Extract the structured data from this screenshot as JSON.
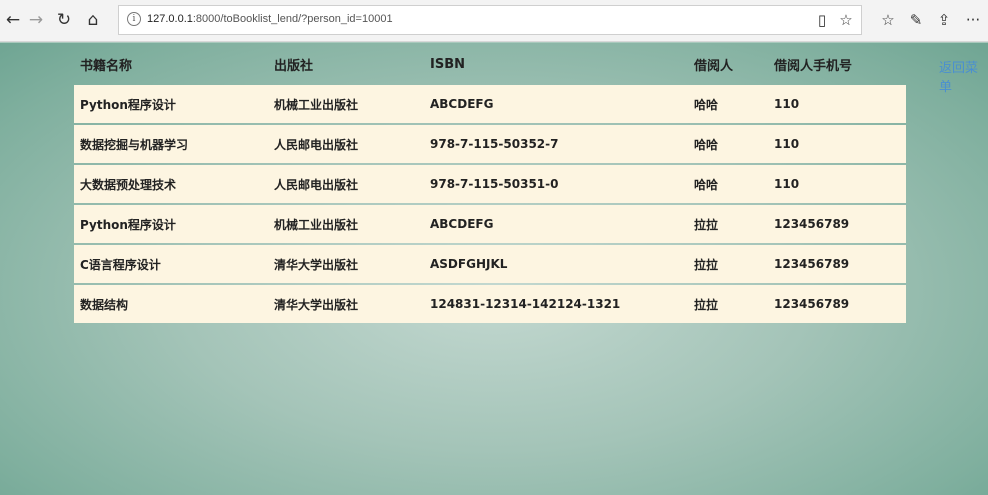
{
  "browser": {
    "url_host": "127.0.0.1",
    "url_rest": ":8000/toBooklist_lend/?person_id=10001",
    "back_icon": "←",
    "forward_icon": "→",
    "refresh_icon": "↻",
    "home_icon": "⌂",
    "info_icon": "i",
    "reading_view_icon": "▯",
    "favorite_icon": "☆",
    "favorites_list_icon": "☆",
    "pen_icon": "✎",
    "share_icon": "⇪",
    "more_icon": "···"
  },
  "page": {
    "back_menu_label": "返回菜单",
    "headers": {
      "name": "书籍名称",
      "publisher": "出版社",
      "isbn": "ISBN",
      "borrower": "借阅人",
      "phone": "借阅人手机号"
    },
    "rows": [
      {
        "name": "Python程序设计",
        "publisher": "机械工业出版社",
        "isbn": "ABCDEFG",
        "borrower": "哈哈",
        "phone": "110"
      },
      {
        "name": "数据挖掘与机器学习",
        "publisher": "人民邮电出版社",
        "isbn": "978-7-115-50352-7",
        "borrower": "哈哈",
        "phone": "110"
      },
      {
        "name": "大数据预处理技术",
        "publisher": "人民邮电出版社",
        "isbn": "978-7-115-50351-0",
        "borrower": "哈哈",
        "phone": "110"
      },
      {
        "name": "Python程序设计",
        "publisher": "机械工业出版社",
        "isbn": "ABCDEFG",
        "borrower": "拉拉",
        "phone": "123456789"
      },
      {
        "name": "C语言程序设计",
        "publisher": "清华大学出版社",
        "isbn": "ASDFGHJKL",
        "borrower": "拉拉",
        "phone": "123456789"
      },
      {
        "name": "数据结构",
        "publisher": "清华大学出版社",
        "isbn": "124831-12314-142124-1321",
        "borrower": "拉拉",
        "phone": "123456789"
      }
    ]
  }
}
